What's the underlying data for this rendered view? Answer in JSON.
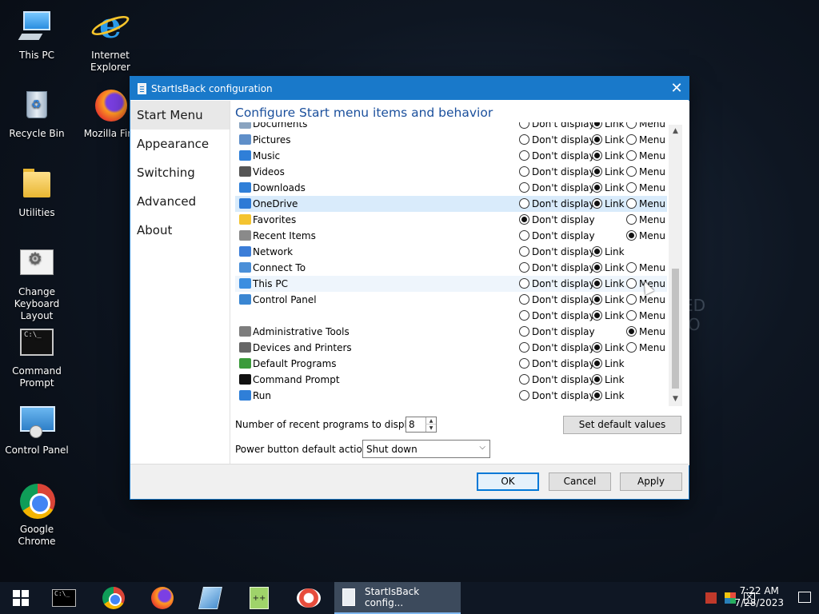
{
  "desktop": {
    "icons": [
      {
        "label": "This PC"
      },
      {
        "label": "Internet Explorer"
      },
      {
        "label": "Recycle Bin"
      },
      {
        "label": "Mozilla Fire"
      },
      {
        "label": "Utilities"
      },
      {
        "label": "Change Keyboard Layout"
      },
      {
        "label": "Command Prompt"
      },
      {
        "label": "Control Panel"
      },
      {
        "label": "Google Chrome"
      }
    ],
    "watermark": [
      "ED",
      "IO"
    ]
  },
  "dialog": {
    "title": "StartIsBack configuration",
    "close_glyph": "✕",
    "nav": [
      "Start Menu",
      "Appearance",
      "Switching",
      "Advanced",
      "About"
    ],
    "active_nav": "Start Menu",
    "heading": "Configure Start menu items and behavior",
    "options": {
      "dont": "Don't display",
      "link": "Link",
      "menu": "Menu"
    },
    "items": [
      {
        "label": "Documents",
        "icon": "documents-icon",
        "choices": [
          "dont",
          "link",
          "menu"
        ],
        "selected": "link"
      },
      {
        "label": "Pictures",
        "icon": "pictures-icon",
        "choices": [
          "dont",
          "link",
          "menu"
        ],
        "selected": "link"
      },
      {
        "label": "Music",
        "icon": "music-icon",
        "choices": [
          "dont",
          "link",
          "menu"
        ],
        "selected": "link"
      },
      {
        "label": "Videos",
        "icon": "videos-icon",
        "choices": [
          "dont",
          "link",
          "menu"
        ],
        "selected": "link"
      },
      {
        "label": "Downloads",
        "icon": "downloads-icon",
        "choices": [
          "dont",
          "link",
          "menu"
        ],
        "selected": "link"
      },
      {
        "label": "OneDrive",
        "icon": "onedrive-icon",
        "choices": [
          "dont",
          "link",
          "menu"
        ],
        "selected": "link",
        "highlight": "selected"
      },
      {
        "label": "Favorites",
        "icon": "favorites-icon",
        "choices": [
          "dont",
          "menu"
        ],
        "selected": "dont"
      },
      {
        "label": "Recent Items",
        "icon": "recent-items-icon",
        "choices": [
          "dont",
          "menu"
        ],
        "selected": "menu"
      },
      {
        "label": "Network",
        "icon": "network-icon",
        "choices": [
          "dont",
          "link"
        ],
        "selected": "link"
      },
      {
        "label": "Connect To",
        "icon": "connect-to-icon",
        "choices": [
          "dont",
          "link",
          "menu"
        ],
        "selected": "link"
      },
      {
        "label": "This PC",
        "icon": "this-pc-icon",
        "choices": [
          "dont",
          "link",
          "menu"
        ],
        "selected": "link",
        "highlight": "hover"
      },
      {
        "label": "Control Panel",
        "icon": "control-panel-icon",
        "choices": [
          "dont",
          "link",
          "menu"
        ],
        "selected": "link"
      },
      {
        "label": "",
        "icon": "",
        "choices": [
          "dont",
          "link",
          "menu"
        ],
        "selected": "link"
      },
      {
        "label": "Administrative Tools",
        "icon": "admin-tools-icon",
        "choices": [
          "dont",
          "menu"
        ],
        "selected": "menu"
      },
      {
        "label": "Devices and Printers",
        "icon": "devices-printers-icon",
        "choices": [
          "dont",
          "link",
          "menu"
        ],
        "selected": "link"
      },
      {
        "label": "Default Programs",
        "icon": "default-programs-icon",
        "choices": [
          "dont",
          "link"
        ],
        "selected": "link"
      },
      {
        "label": "Command Prompt",
        "icon": "command-prompt-icon",
        "choices": [
          "dont",
          "link"
        ],
        "selected": "link"
      },
      {
        "label": "Run",
        "icon": "run-icon",
        "choices": [
          "dont",
          "link"
        ],
        "selected": "link"
      }
    ],
    "recent_label": "Number of recent programs to display:",
    "recent_value": "8",
    "set_default_label": "Set default values",
    "power_label": "Power button default action:",
    "power_value": "Shut down",
    "ok_label": "OK",
    "cancel_label": "Cancel",
    "apply_label": "Apply"
  },
  "taskbar": {
    "active_window_label": "StartIsBack config...",
    "time": "7:22 AM",
    "date": "7/28/2023"
  },
  "colors": {
    "accent": "#1979ca",
    "heading": "#1a4f9c",
    "row_selected": "#d9ebfb",
    "row_hover": "#eef5fc"
  }
}
